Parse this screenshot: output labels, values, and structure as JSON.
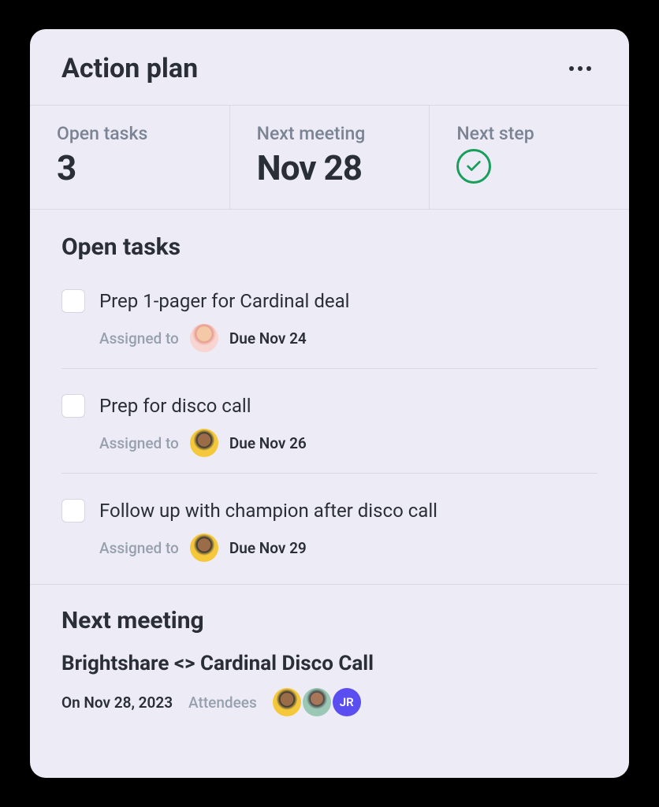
{
  "header": {
    "title": "Action plan"
  },
  "stats": {
    "open_tasks_label": "Open tasks",
    "open_tasks_value": "3",
    "next_meeting_label": "Next meeting",
    "next_meeting_value": "Nov 28",
    "next_step_label": "Next step"
  },
  "open_tasks_section": {
    "title": "Open tasks"
  },
  "tasks": [
    {
      "title": "Prep 1-pager for Cardinal deal",
      "assigned_label": "Assigned to",
      "due": "Due Nov 24",
      "avatar": "avatar-1"
    },
    {
      "title": "Prep for disco call",
      "assigned_label": "Assigned to",
      "due": "Due Nov 26",
      "avatar": "avatar-2"
    },
    {
      "title": "Follow up with champion after disco call",
      "assigned_label": "Assigned to",
      "due": "Due Nov 29",
      "avatar": "avatar-2"
    }
  ],
  "next_meeting_section": {
    "title": "Next meeting",
    "meeting_title": "Brightshare <> Cardinal Disco Call",
    "date": "On Nov 28, 2023",
    "attendees_label": "Attendees",
    "attendees": [
      {
        "type": "avatar",
        "class": "avatar-2"
      },
      {
        "type": "avatar",
        "class": "avatar-3"
      },
      {
        "type": "initials",
        "text": "JR"
      }
    ]
  }
}
